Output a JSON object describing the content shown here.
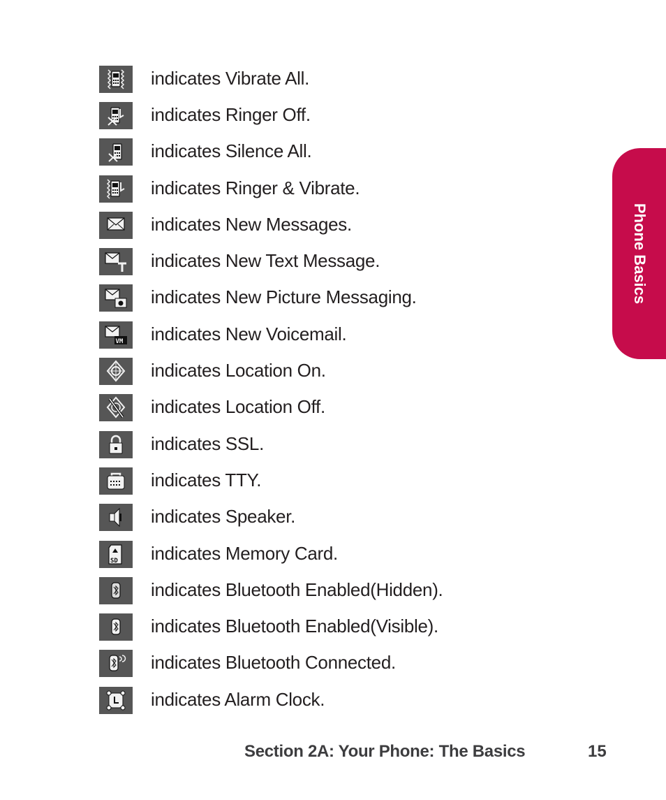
{
  "items": [
    {
      "icon": "vibrate-all-icon",
      "text": "indicates Vibrate All."
    },
    {
      "icon": "ringer-off-icon",
      "text": "indicates Ringer Off."
    },
    {
      "icon": "silence-all-icon",
      "text": "indicates Silence All."
    },
    {
      "icon": "ringer-vibrate-icon",
      "text": "indicates Ringer & Vibrate."
    },
    {
      "icon": "new-messages-icon",
      "text": "indicates New Messages."
    },
    {
      "icon": "new-text-message-icon",
      "text": "indicates New Text Message."
    },
    {
      "icon": "new-picture-messaging-icon",
      "text": "indicates New Picture Messaging."
    },
    {
      "icon": "new-voicemail-icon",
      "text": "indicates New Voicemail."
    },
    {
      "icon": "location-on-icon",
      "text": "indicates Location On."
    },
    {
      "icon": "location-off-icon",
      "text": "indicates Location Off."
    },
    {
      "icon": "ssl-lock-icon",
      "text": "indicates SSL."
    },
    {
      "icon": "tty-icon",
      "text": "indicates TTY."
    },
    {
      "icon": "speaker-icon",
      "text": "indicates Speaker."
    },
    {
      "icon": "memory-card-icon",
      "text": "indicates Memory Card."
    },
    {
      "icon": "bluetooth-hidden-icon",
      "text": "indicates Bluetooth Enabled(Hidden)."
    },
    {
      "icon": "bluetooth-visible-icon",
      "text": "indicates Bluetooth Enabled(Visible)."
    },
    {
      "icon": "bluetooth-connected-icon",
      "text": "indicates Bluetooth Connected."
    },
    {
      "icon": "alarm-clock-icon",
      "text": "indicates Alarm Clock."
    }
  ],
  "side_tab": {
    "label": "Phone Basics",
    "color": "#c60c4b"
  },
  "footer": {
    "section": "Section 2A: Your Phone: The Basics",
    "page_number": "15"
  }
}
